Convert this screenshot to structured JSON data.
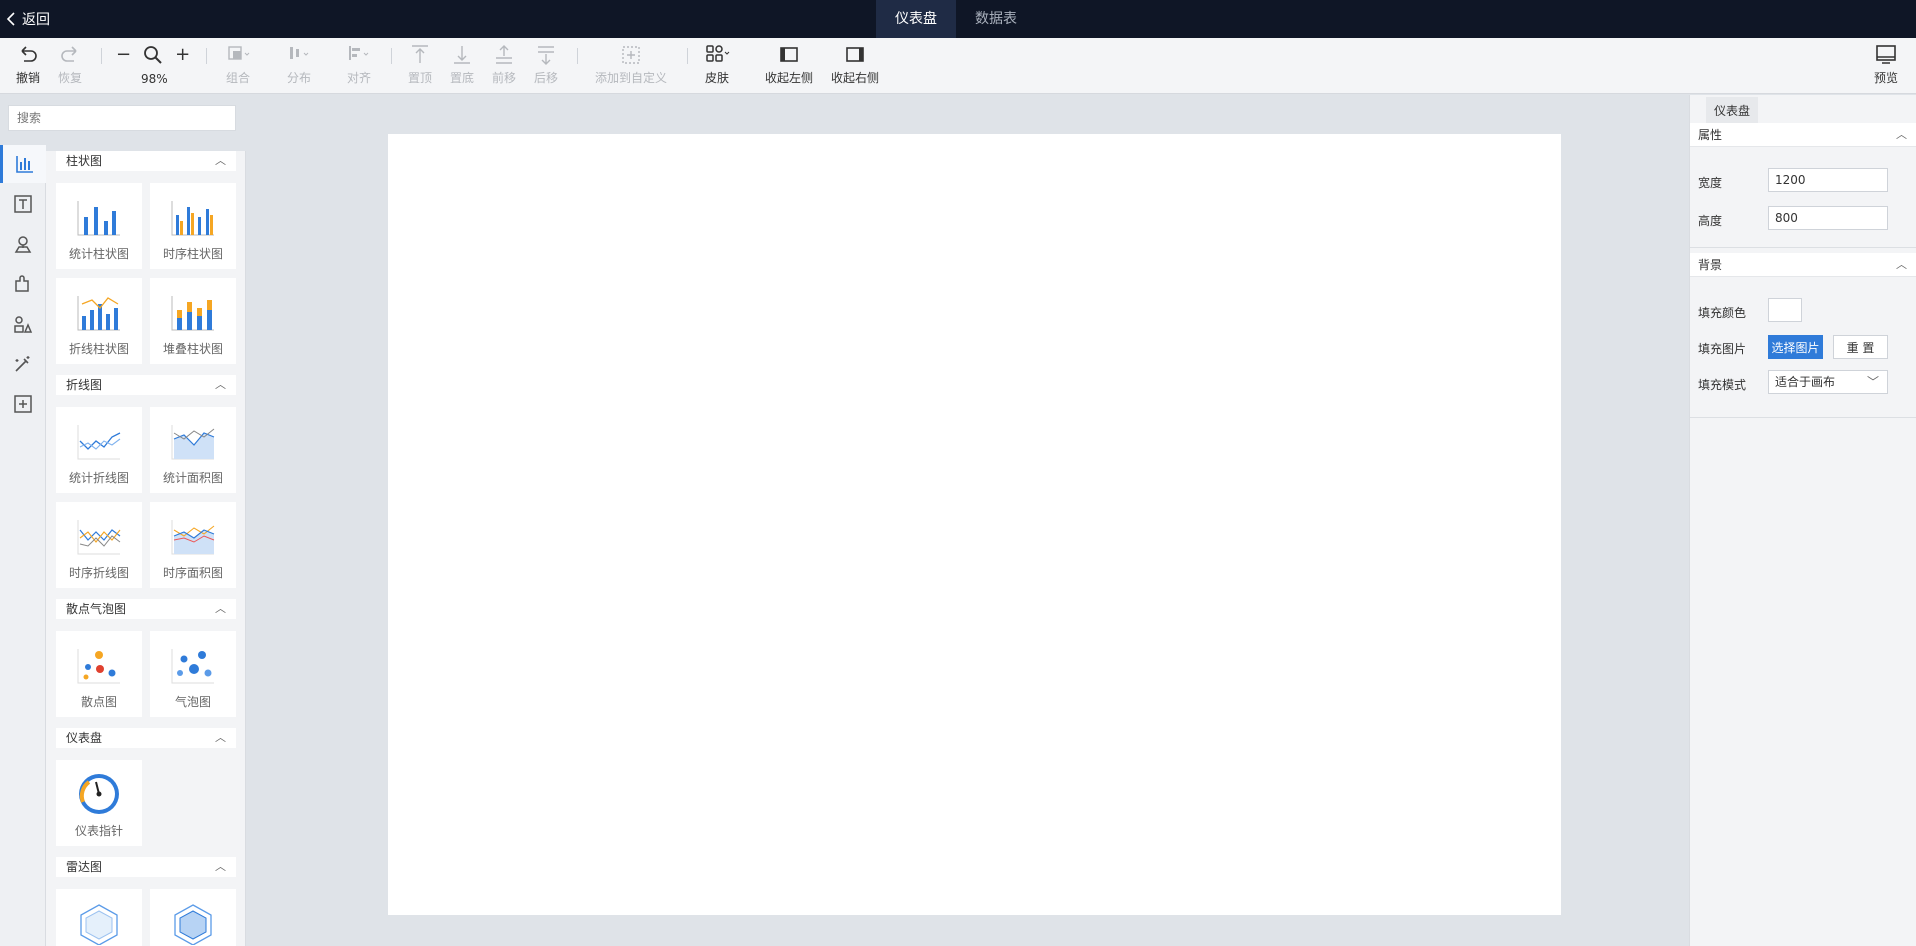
{
  "topbar": {
    "back_label": "返回",
    "tabs": [
      {
        "label": "仪表盘",
        "active": true
      },
      {
        "label": "数据表",
        "active": false
      }
    ]
  },
  "toolbar": {
    "undo": "撤销",
    "redo": "恢复",
    "zoom": "98%",
    "group": "组合",
    "distribute": "分布",
    "align": "对齐",
    "to_top": "置顶",
    "to_bottom": "置底",
    "forward": "前移",
    "backward": "后移",
    "add_custom": "添加到自定义",
    "skin": "皮肤",
    "collapse_left": "收起左侧",
    "collapse_right": "收起右侧",
    "preview": "预览"
  },
  "left_panel": {
    "search_placeholder": "搜索",
    "sections": [
      {
        "title": "柱状图",
        "items": [
          "统计柱状图",
          "时序柱状图",
          "折线柱状图",
          "堆叠柱状图"
        ]
      },
      {
        "title": "折线图",
        "items": [
          "统计折线图",
          "统计面积图",
          "时序折线图",
          "时序面积图"
        ]
      },
      {
        "title": "散点气泡图",
        "items": [
          "散点图",
          "气泡图"
        ]
      },
      {
        "title": "仪表盘",
        "items": [
          "仪表指针"
        ]
      },
      {
        "title": "雷达图",
        "items": []
      }
    ]
  },
  "right_panel": {
    "tab": "仪表盘",
    "attr_section": "属性",
    "width_label": "宽度",
    "width_value": "1200",
    "height_label": "高度",
    "height_value": "800",
    "bg_section": "背景",
    "fill_color_label": "填充颜色",
    "fill_image_label": "填充图片",
    "choose_image": "选择图片",
    "reset": "重 置",
    "fill_mode_label": "填充模式",
    "fill_mode_value": "适合于画布"
  },
  "colors": {
    "accent": "#2f7bd9",
    "topbar": "#0f1626"
  }
}
